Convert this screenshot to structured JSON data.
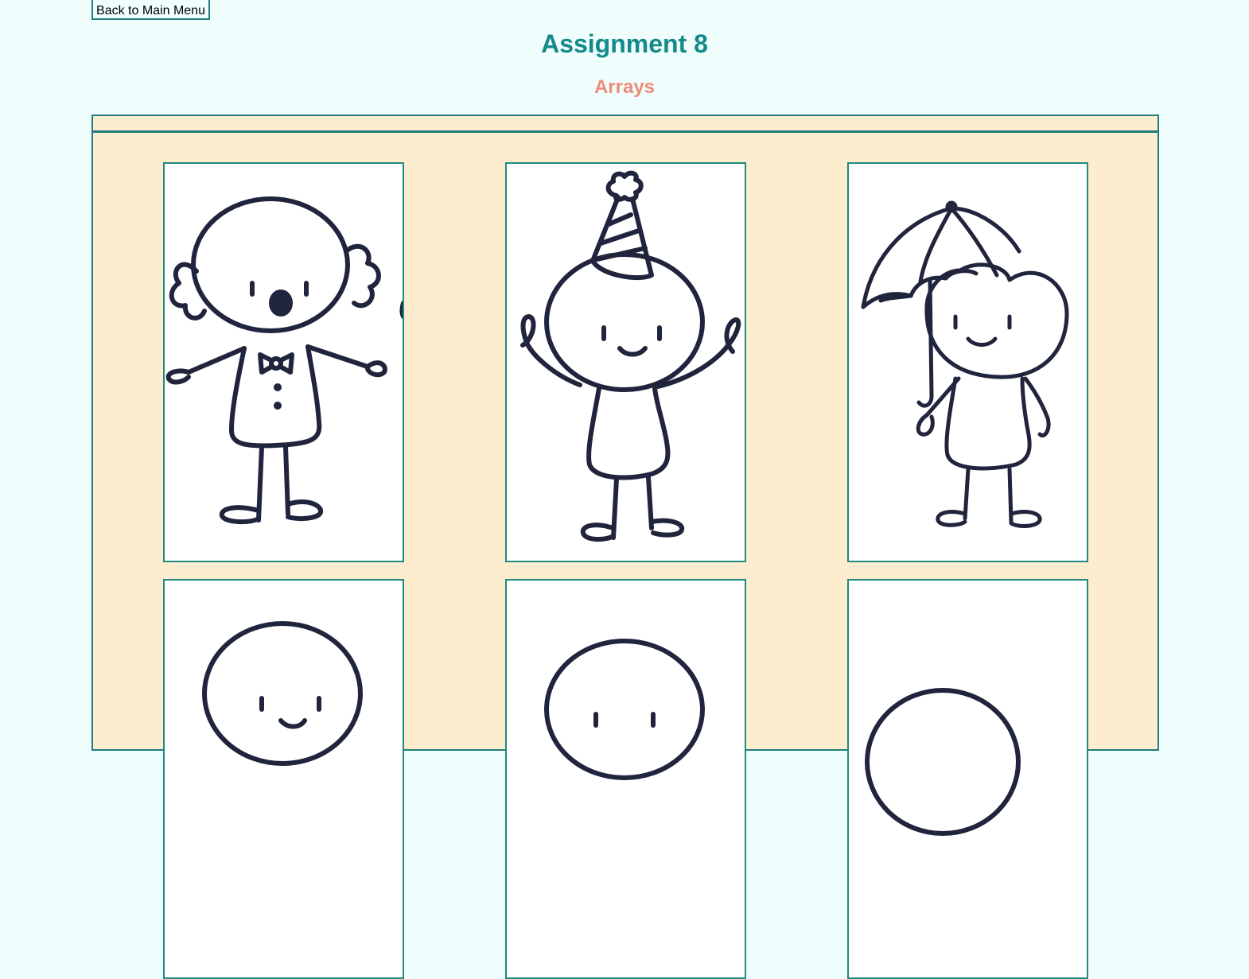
{
  "nav": {
    "back_label": "Back to Main Menu"
  },
  "header": {
    "title": "Assignment 8",
    "subtitle": "Arrays"
  },
  "gallery": {
    "cards": [
      {
        "name": "clown-figure"
      },
      {
        "name": "party-hat-figure"
      },
      {
        "name": "umbrella-figure"
      },
      {
        "name": "smiling-figure-1"
      },
      {
        "name": "smiling-figure-2"
      },
      {
        "name": "round-head-figure"
      }
    ]
  },
  "colors": {
    "page_background": "#effdfd",
    "title": "#138a8a",
    "subtitle": "#f08a7a",
    "panel_background": "#feeccf",
    "border": "#1f7d7d",
    "ink": "#20243d"
  }
}
